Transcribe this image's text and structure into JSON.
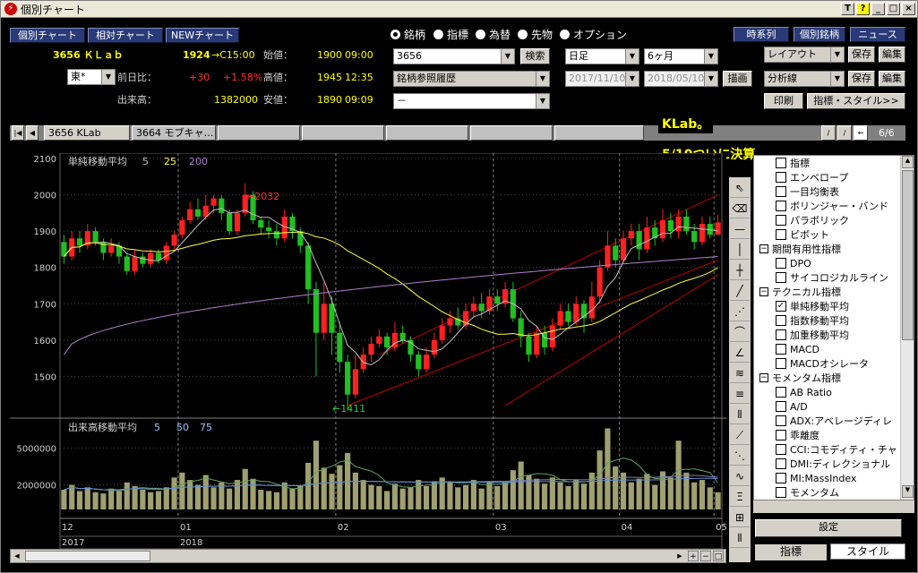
{
  "window": {
    "title": "個別チャート",
    "buttons": [
      "T",
      "?",
      "_",
      "□",
      "×"
    ]
  },
  "views": [
    "個別チャート",
    "相対チャート",
    "NEWチャート"
  ],
  "quote": {
    "code_name": "3656 ＫＬａｂ",
    "price": "1924",
    "price_time": "→C15:00",
    "change_label": "前日比：",
    "change": "+30",
    "change_pct": "+1.58%",
    "volume_label": "出来高：",
    "volume": "1382000",
    "market": "東*",
    "open_label": "始値：",
    "open": "1900",
    "open_time": "09:00",
    "high_label": "高値：",
    "high": "1945",
    "high_time": "12:35",
    "low_label": "安値：",
    "low": "1890",
    "low_time": "09:09"
  },
  "asset_types": [
    "銘柄",
    "指標",
    "為替",
    "先物",
    "オプション"
  ],
  "search": {
    "code": "3656",
    "button": "検索",
    "history": "銘柄参照履歴",
    "sub": "－"
  },
  "period": {
    "interval": "日足",
    "range": "6ヶ月",
    "from": "2017/11/10",
    "to": "2018/05/10",
    "draw": "描画"
  },
  "right_buttons": {
    "timeseries": "時系列",
    "individual": "個別銘柄",
    "news": "ニュース"
  },
  "layout": {
    "label": "レイアウト",
    "save": "保存",
    "edit": "編集"
  },
  "analysis": {
    "label": "分析線",
    "save": "保存",
    "edit": "編集"
  },
  "print": "印刷",
  "indicator_style": "指標・スタイル>>",
  "tabs": [
    "3656 KLab",
    "3664 モブキャ…"
  ],
  "tab_count": "6/6",
  "annotation": [
    "KLab。",
    "5/10ついに決算。"
  ],
  "main_chart": {
    "title": "単純移動平均",
    "p1": "5",
    "p2": "25",
    "p3": "200",
    "high_mark": "←2032",
    "low_mark": "←1411",
    "yticks": [
      "2100",
      "2000",
      "1900",
      "1800",
      "1700",
      "1600",
      "1500"
    ]
  },
  "volume_chart": {
    "title": "出来高移動平均",
    "p1": "5",
    "p2": "50",
    "p3": "75",
    "yticks": [
      "5000000",
      "2000000"
    ]
  },
  "xaxis": {
    "months": [
      "12",
      "01",
      "02",
      "03",
      "04",
      "05"
    ],
    "years": [
      "2017",
      "2018"
    ]
  },
  "chart_data": {
    "type": "candlestick",
    "title": "",
    "y_range": [
      1400,
      2100
    ],
    "yticks": [
      2100,
      2000,
      1900,
      1800,
      1700,
      1600,
      1500
    ],
    "ma_periods": [
      5,
      25,
      200
    ],
    "annotations": [
      {
        "label": "2032",
        "value": 2032
      },
      {
        "label": "1411",
        "value": 1411
      }
    ],
    "candles": [
      [
        1870,
        1830,
        1890,
        1810
      ],
      [
        1830,
        1880,
        1900,
        1820
      ],
      [
        1880,
        1860,
        1900,
        1840
      ],
      [
        1860,
        1900,
        1920,
        1850
      ],
      [
        1900,
        1870,
        1910,
        1860
      ],
      [
        1870,
        1840,
        1880,
        1820
      ],
      [
        1840,
        1860,
        1880,
        1830
      ],
      [
        1860,
        1830,
        1870,
        1810
      ],
      [
        1830,
        1790,
        1840,
        1780
      ],
      [
        1790,
        1830,
        1850,
        1780
      ],
      [
        1830,
        1810,
        1840,
        1800
      ],
      [
        1810,
        1840,
        1850,
        1800
      ],
      [
        1840,
        1820,
        1850,
        1810
      ],
      [
        1820,
        1860,
        1870,
        1810
      ],
      [
        1860,
        1890,
        1900,
        1850
      ],
      [
        1890,
        1930,
        1940,
        1880
      ],
      [
        1930,
        1960,
        1980,
        1920
      ],
      [
        1960,
        1940,
        1990,
        1930
      ],
      [
        1940,
        1970,
        2000,
        1930
      ],
      [
        1970,
        1990,
        2000,
        1950
      ],
      [
        1990,
        1950,
        2000,
        1930
      ],
      [
        1950,
        1900,
        1960,
        1890
      ],
      [
        1900,
        1950,
        1960,
        1890
      ],
      [
        1950,
        2000,
        2032,
        1940
      ],
      [
        2000,
        1930,
        2010,
        1920
      ],
      [
        1930,
        1910,
        1940,
        1890
      ],
      [
        1910,
        1900,
        1930,
        1880
      ],
      [
        1900,
        1880,
        1920,
        1860
      ],
      [
        1880,
        1940,
        1960,
        1870
      ],
      [
        1940,
        1900,
        1950,
        1880
      ],
      [
        1900,
        1860,
        1910,
        1840
      ],
      [
        1860,
        1740,
        1870,
        1700
      ],
      [
        1740,
        1620,
        1760,
        1500
      ],
      [
        1620,
        1700,
        1760,
        1600
      ],
      [
        1700,
        1620,
        1720,
        1560
      ],
      [
        1620,
        1540,
        1650,
        1510
      ],
      [
        1540,
        1450,
        1560,
        1411
      ],
      [
        1450,
        1520,
        1560,
        1440
      ],
      [
        1520,
        1560,
        1580,
        1510
      ],
      [
        1560,
        1590,
        1610,
        1540
      ],
      [
        1590,
        1610,
        1630,
        1580
      ],
      [
        1610,
        1580,
        1620,
        1560
      ],
      [
        1580,
        1620,
        1650,
        1570
      ],
      [
        1620,
        1600,
        1640,
        1590
      ],
      [
        1600,
        1560,
        1610,
        1540
      ],
      [
        1560,
        1520,
        1570,
        1500
      ],
      [
        1520,
        1560,
        1580,
        1510
      ],
      [
        1560,
        1600,
        1620,
        1550
      ],
      [
        1600,
        1640,
        1660,
        1590
      ],
      [
        1640,
        1660,
        1680,
        1620
      ],
      [
        1660,
        1640,
        1690,
        1630
      ],
      [
        1640,
        1680,
        1700,
        1630
      ],
      [
        1680,
        1700,
        1720,
        1660
      ],
      [
        1700,
        1680,
        1730,
        1660
      ],
      [
        1680,
        1720,
        1740,
        1670
      ],
      [
        1720,
        1700,
        1740,
        1680
      ],
      [
        1700,
        1740,
        1760,
        1690
      ],
      [
        1740,
        1660,
        1760,
        1650
      ],
      [
        1660,
        1610,
        1680,
        1580
      ],
      [
        1610,
        1560,
        1620,
        1540
      ],
      [
        1560,
        1620,
        1640,
        1550
      ],
      [
        1620,
        1580,
        1640,
        1560
      ],
      [
        1580,
        1640,
        1660,
        1570
      ],
      [
        1640,
        1680,
        1700,
        1630
      ],
      [
        1680,
        1650,
        1700,
        1640
      ],
      [
        1650,
        1700,
        1720,
        1640
      ],
      [
        1700,
        1660,
        1710,
        1620
      ],
      [
        1660,
        1720,
        1760,
        1650
      ],
      [
        1720,
        1800,
        1820,
        1700
      ],
      [
        1800,
        1860,
        1900,
        1790
      ],
      [
        1860,
        1820,
        1880,
        1800
      ],
      [
        1820,
        1880,
        1900,
        1810
      ],
      [
        1880,
        1900,
        1920,
        1860
      ],
      [
        1900,
        1850,
        1920,
        1820
      ],
      [
        1850,
        1910,
        1940,
        1840
      ],
      [
        1910,
        1880,
        1930,
        1860
      ],
      [
        1880,
        1930,
        1960,
        1870
      ],
      [
        1930,
        1900,
        1950,
        1880
      ],
      [
        1900,
        1940,
        1960,
        1880
      ],
      [
        1940,
        1900,
        1960,
        1890
      ],
      [
        1900,
        1870,
        1920,
        1850
      ],
      [
        1870,
        1920,
        1940,
        1860
      ],
      [
        1920,
        1890,
        1940,
        1880
      ],
      [
        1890,
        1924,
        1945,
        1890
      ]
    ],
    "volume_range": [
      0,
      7000000
    ],
    "volumes": [
      1.6,
      2.0,
      1.5,
      1.8,
      1.4,
      1.3,
      1.7,
      1.5,
      2.2,
      1.9,
      1.6,
      1.4,
      1.5,
      1.8,
      2.6,
      3.0,
      2.4,
      2.0,
      2.8,
      1.8,
      2.2,
      1.7,
      2.4,
      3.3,
      2.5,
      1.6,
      1.5,
      1.4,
      2.2,
      1.7,
      1.9,
      3.8,
      5.6,
      3.4,
      2.9,
      3.6,
      4.6,
      3.0,
      2.4,
      2.0,
      1.9,
      1.5,
      2.1,
      1.7,
      1.8,
      2.4,
      1.9,
      2.3,
      2.6,
      2.2,
      1.8,
      2.0,
      2.4,
      1.7,
      2.3,
      1.9,
      2.2,
      3.2,
      3.9,
      2.8,
      2.5,
      2.1,
      2.6,
      2.2,
      1.9,
      2.4,
      2.1,
      3.0,
      4.8,
      6.6,
      3.5,
      3.0,
      2.2,
      2.5,
      2.9,
      2.0,
      3.1,
      2.6,
      5.6,
      3.0,
      2.2,
      2.4,
      1.8,
      1.4
    ]
  },
  "indicator_panel": {
    "items": [
      {
        "kind": "item",
        "label": "指標"
      },
      {
        "kind": "item",
        "label": "エンベロープ"
      },
      {
        "kind": "item",
        "label": "一目均衡表"
      },
      {
        "kind": "item",
        "label": "ボリンジャー・バンド"
      },
      {
        "kind": "item",
        "label": "パラボリック"
      },
      {
        "kind": "item",
        "label": "ピボット"
      },
      {
        "kind": "group",
        "label": "期間有用性指標"
      },
      {
        "kind": "item",
        "label": "DPO"
      },
      {
        "kind": "item",
        "label": "サイコロジカルライン"
      },
      {
        "kind": "group",
        "label": "テクニカル指標"
      },
      {
        "kind": "item",
        "label": "単純移動平均",
        "checked": true
      },
      {
        "kind": "item",
        "label": "指数移動平均"
      },
      {
        "kind": "item",
        "label": "加重移動平均"
      },
      {
        "kind": "item",
        "label": "MACD"
      },
      {
        "kind": "item",
        "label": "MACDオシレータ"
      },
      {
        "kind": "group",
        "label": "モメンタム指標"
      },
      {
        "kind": "item",
        "label": "AB Ratio"
      },
      {
        "kind": "item",
        "label": "A/D"
      },
      {
        "kind": "item",
        "label": "ADX:アベレージディレ"
      },
      {
        "kind": "item",
        "label": "乖離度"
      },
      {
        "kind": "item",
        "label": "CCI:コモディティ・チャ"
      },
      {
        "kind": "item",
        "label": "DMI:ディレクショナル"
      },
      {
        "kind": "item",
        "label": "MI:MassIndex"
      },
      {
        "kind": "item",
        "label": "モメンタム"
      }
    ],
    "settings": "設定",
    "tab_indicator": "指標",
    "tab_style": "スタイル"
  },
  "colors": {
    "up": "#ff2020",
    "down": "#20c020",
    "ma5": "#c0c0c0",
    "ma25": "#ffff40",
    "ma200": "#b080d0",
    "trend": "#c00000",
    "volume": "#a0a070"
  }
}
